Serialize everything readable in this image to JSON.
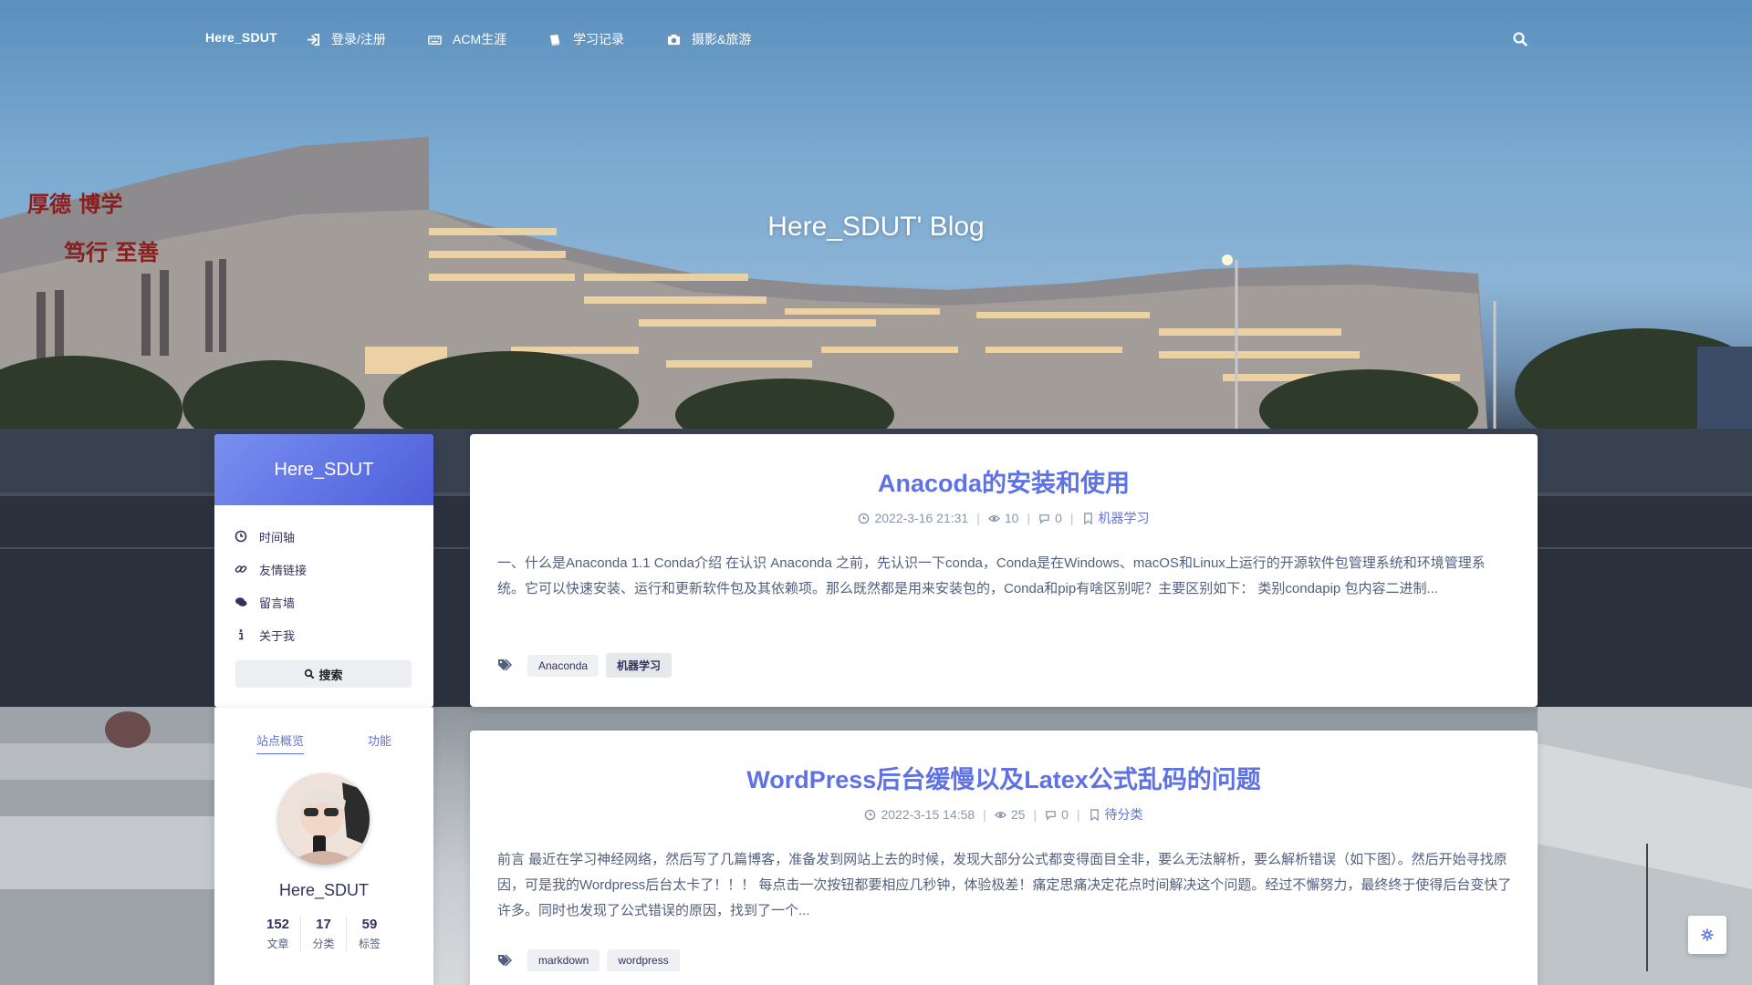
{
  "nav": {
    "brand": "Here_SDUT",
    "items": [
      {
        "label": "登录/注册",
        "icon": "sign-in-icon"
      },
      {
        "label": "ACM生涯",
        "icon": "keyboard-icon"
      },
      {
        "label": "学习记录",
        "icon": "book-icon"
      },
      {
        "label": "摄影&旅游",
        "icon": "camera-icon"
      }
    ]
  },
  "hero": {
    "title": "Here_SDUT' Blog",
    "banner_text": [
      "厚德 博学",
      "笃行 至善"
    ]
  },
  "sidebar": {
    "title": "Here_SDUT",
    "menu": [
      {
        "label": "时间轴",
        "icon": "clock-icon"
      },
      {
        "label": "友情链接",
        "icon": "link-icon"
      },
      {
        "label": "留言墙",
        "icon": "comments-icon"
      },
      {
        "label": "关于我",
        "icon": "info-icon"
      }
    ],
    "search_label": "搜索",
    "tabs": [
      "站点概览",
      "功能"
    ],
    "author": "Here_SDUT",
    "stats": [
      {
        "value": "152",
        "label": "文章"
      },
      {
        "value": "17",
        "label": "分类"
      },
      {
        "value": "59",
        "label": "标签"
      }
    ]
  },
  "posts": [
    {
      "title": "Anacoda的安装和使用",
      "date": "2022-3-16 21:31",
      "views": "10",
      "comments": "0",
      "category": "机器学习",
      "excerpt": "一、什么是Anaconda 1.1 Conda介绍 在认识 Anaconda 之前，先认识一下conda，Conda是在Windows、macOS和Linux上运行的开源软件包管理系统和环境管理系统。它可以快速安装、运行和更新软件包及其依赖项。那么既然都是用来安装包的，Conda和pip有啥区别呢？主要区别如下： 类别condapip 包内容二进制...",
      "tags": [
        "Anaconda",
        "机器学习"
      ]
    },
    {
      "title": "WordPress后台缓慢以及Latex公式乱码的问题",
      "date": "2022-3-15 14:58",
      "views": "25",
      "comments": "0",
      "category": "待分类",
      "excerpt": "前言 最近在学习神经网络，然后写了几篇博客，准备发到网站上去的时候，发现大部分公式都变得面目全非，要么无法解析，要么解析错误（如下图）。然后开始寻找原因，可是我的Wordpress后台太卡了！！！ 每点击一次按钮都要相应几秒钟，体验极差！痛定思痛决定花点时间解决这个问题。经过不懈努力，最终终于使得后台变快了许多。同时也发现了公式错误的原因，找到了一个...",
      "tags": [
        "markdown",
        "wordpress"
      ]
    }
  ],
  "colors": {
    "accent": "#5e72e4",
    "text": "#32325d",
    "muted": "#8898aa"
  }
}
